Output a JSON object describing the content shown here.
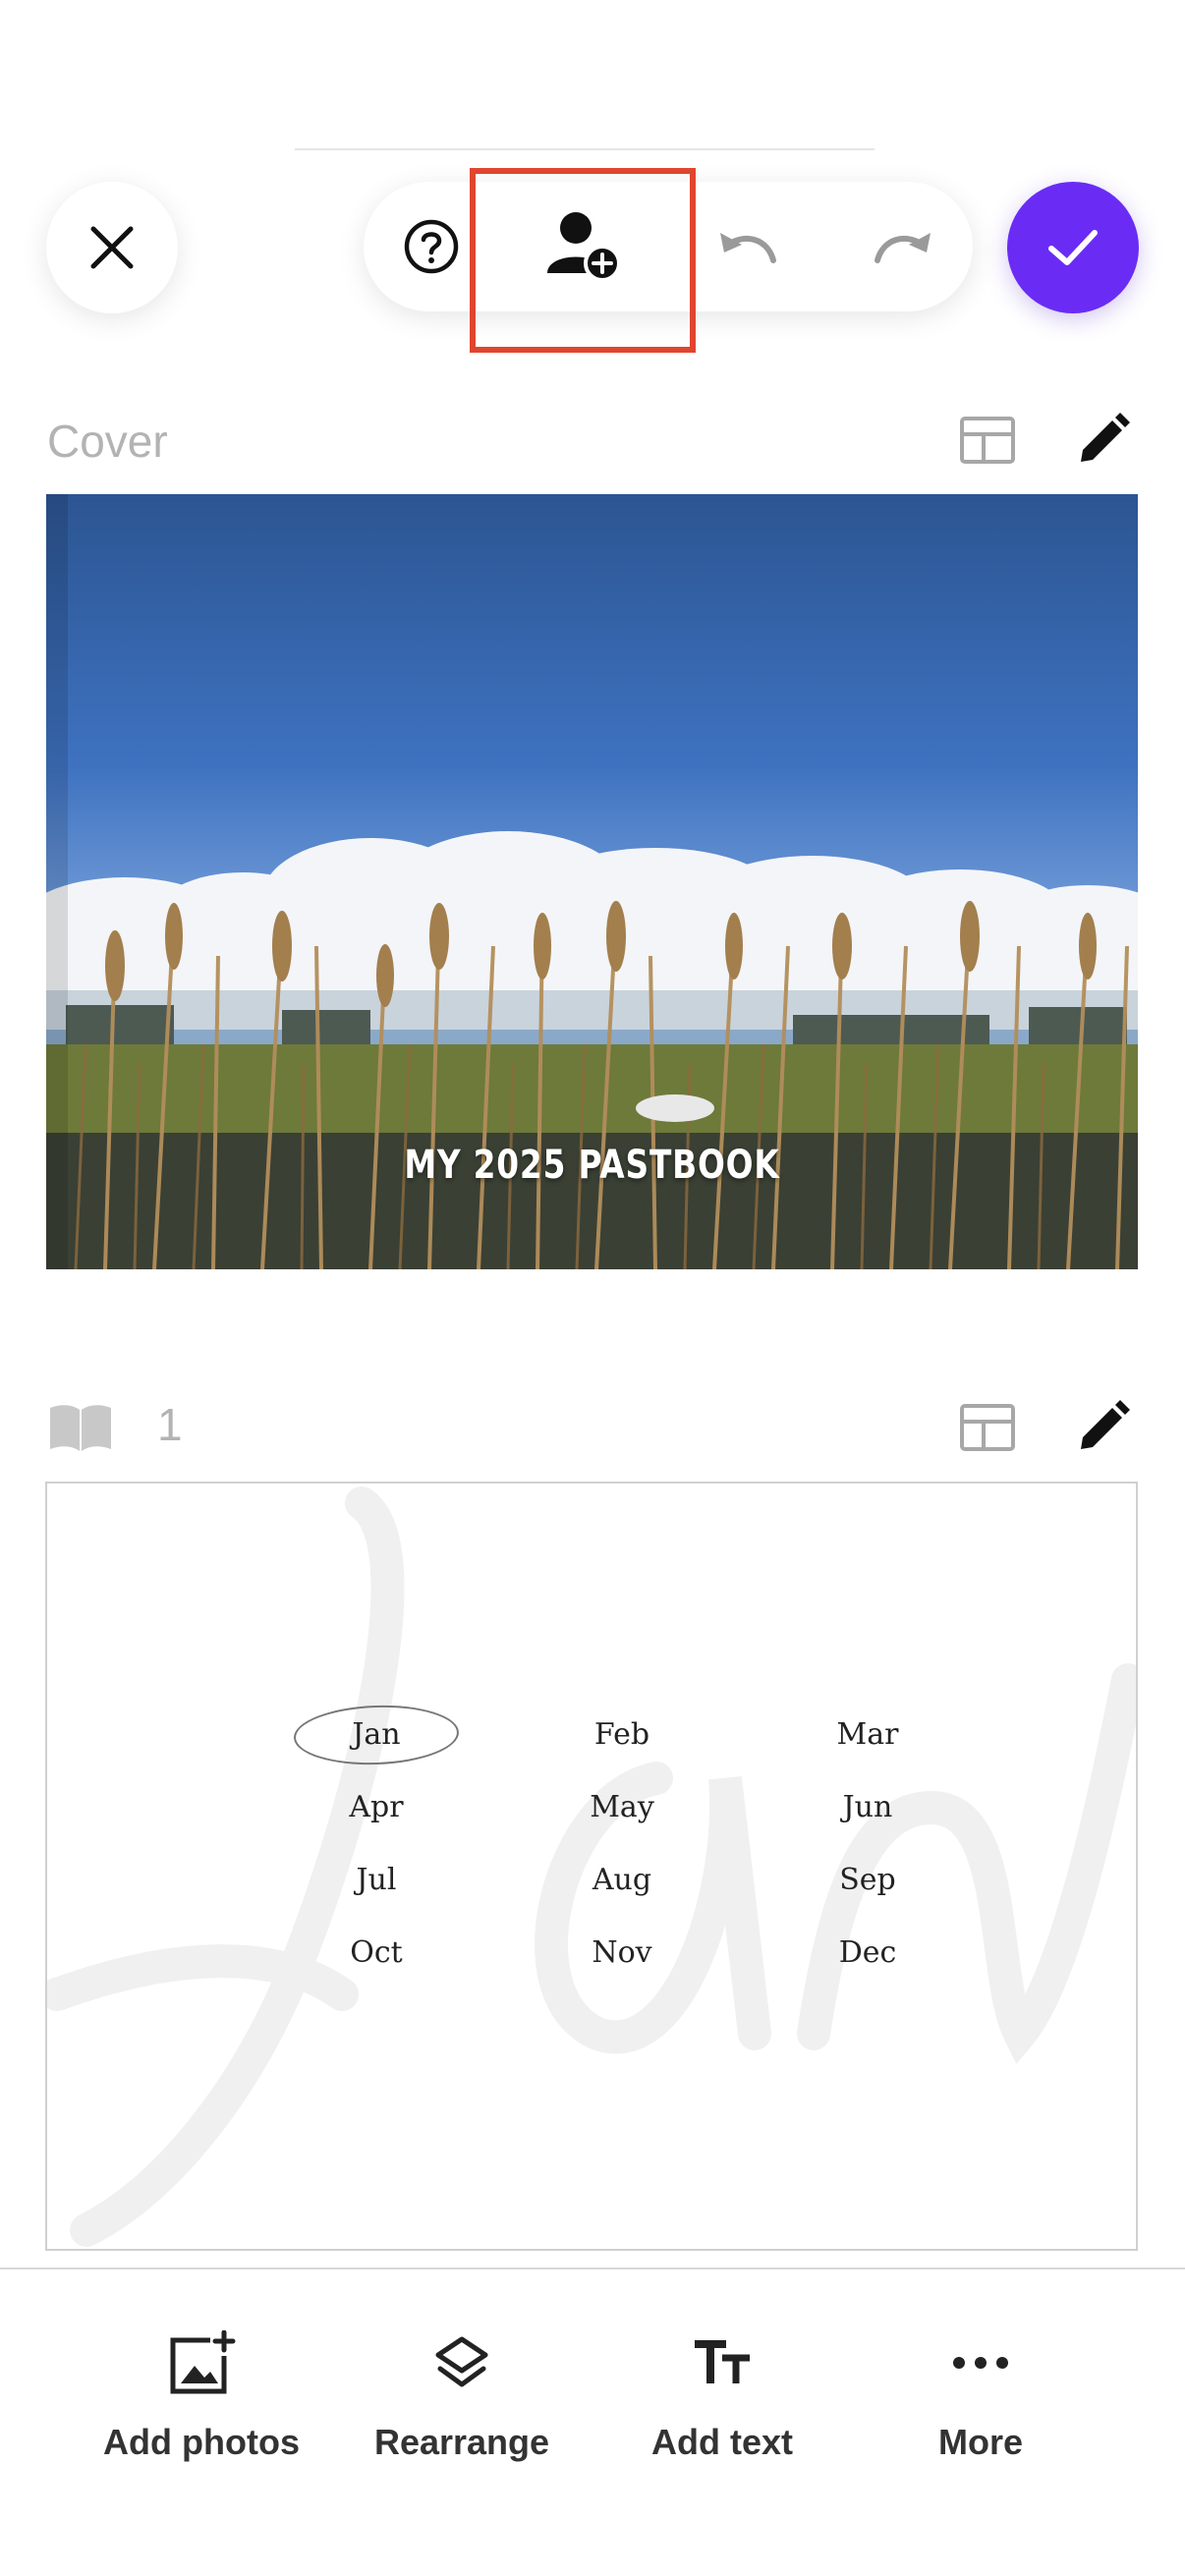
{
  "toolbar": {
    "close_icon": "close-icon",
    "help_icon": "help-icon",
    "add_collaborator_icon": "person-add-icon",
    "undo_icon": "undo-icon",
    "redo_icon": "redo-icon",
    "confirm_icon": "check-icon"
  },
  "colors": {
    "accent": "#6a2cf5",
    "highlight": "#e0452f"
  },
  "cover": {
    "label": "Cover",
    "title": "MY 2025 PASTBOOK"
  },
  "page": {
    "number": "1",
    "months": [
      "Jan",
      "Feb",
      "Mar",
      "Apr",
      "May",
      "Jun",
      "Jul",
      "Aug",
      "Sep",
      "Oct",
      "Nov",
      "Dec"
    ],
    "selected_month": "Jan"
  },
  "bottom_bar": {
    "add_photos": "Add photos",
    "rearrange": "Rearrange",
    "add_text": "Add text",
    "more": "More"
  }
}
